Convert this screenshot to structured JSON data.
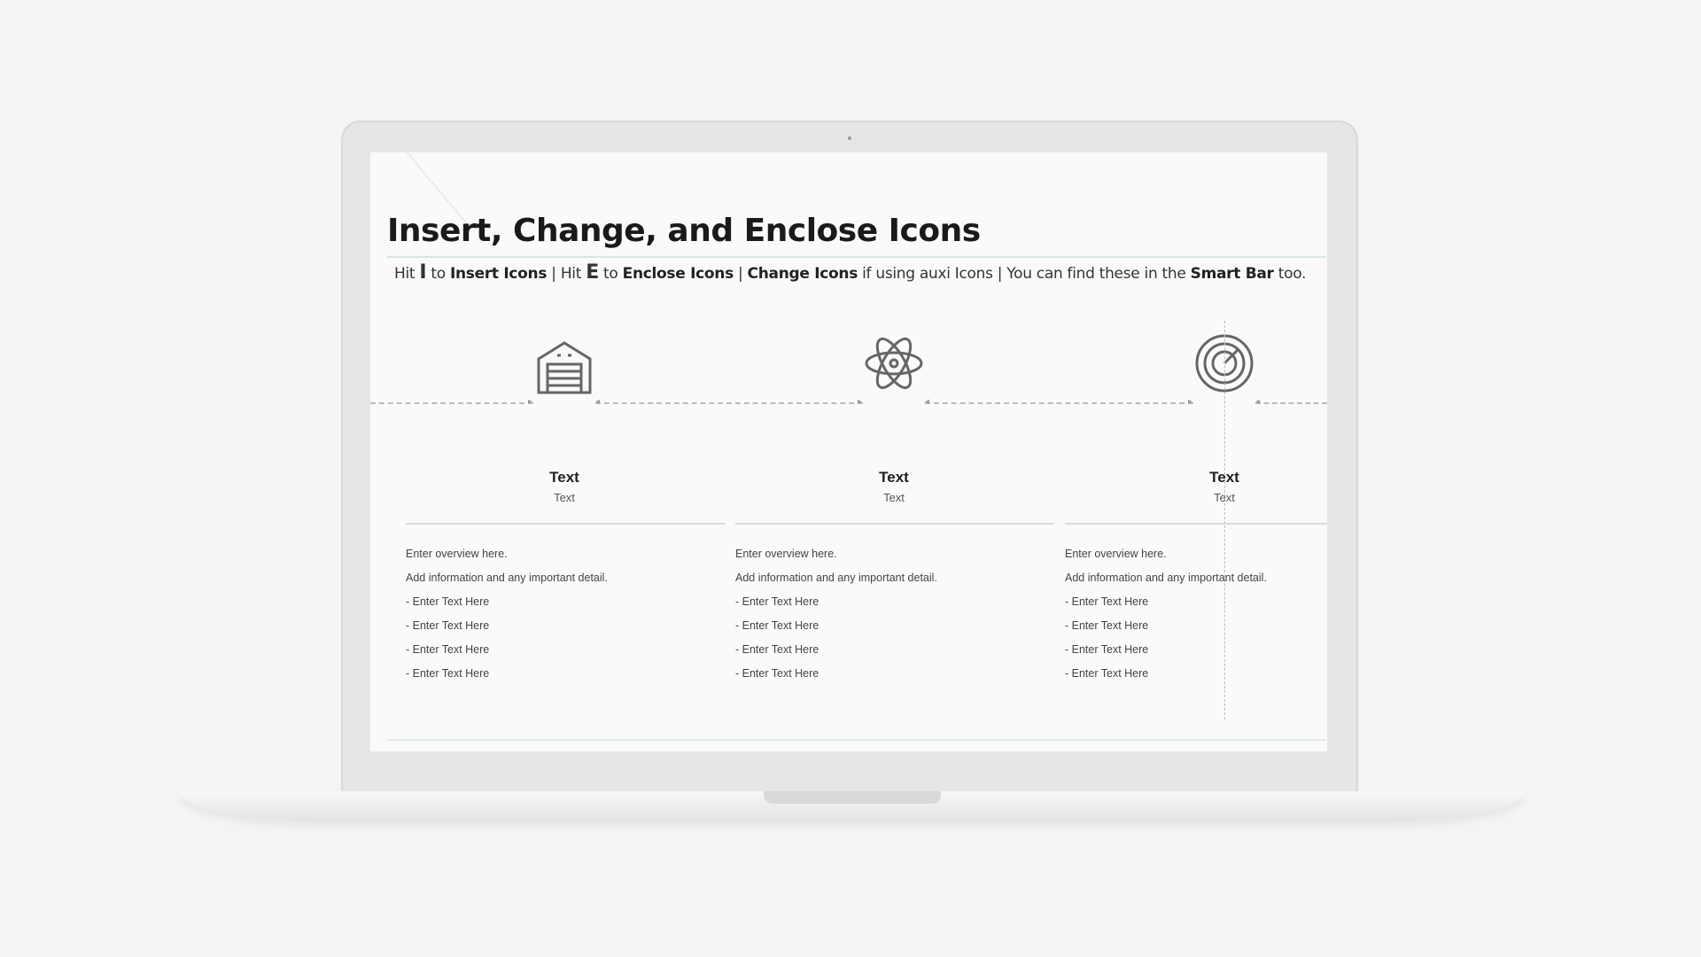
{
  "slide": {
    "title": "Insert, Change, and Enclose Icons",
    "subtitle": {
      "p1": "Hit ",
      "key_i": "I",
      "p2": " to ",
      "insert": "Insert Icons",
      "sep1": " |  Hit ",
      "key_e": "E",
      "p3": " to ",
      "enclose": "Enclose Icons",
      "sep2": " |  ",
      "change": "Change Icons",
      "p4": " if using auxi Icons |  You can find these in the ",
      "smartbar": "Smart Bar",
      "p5": " too."
    },
    "columns": [
      {
        "icon": "garage-icon",
        "title": "Text",
        "sub": "Text",
        "lines": [
          "Enter overview here.",
          "Add information and any important detail.",
          "- Enter Text Here",
          "- Enter Text Here",
          "- Enter Text Here",
          "- Enter Text Here"
        ]
      },
      {
        "icon": "atom-icon",
        "title": "Text",
        "sub": "Text",
        "lines": [
          "Enter overview here.",
          "Add information and any important detail.",
          "- Enter Text Here",
          "- Enter Text Here",
          "- Enter Text Here",
          "- Enter Text Here"
        ]
      },
      {
        "icon": "target-icon",
        "title": "Text",
        "sub": "Text",
        "lines": [
          "Enter overview here.",
          "Add information and any important detail.",
          "- Enter Text Here",
          "- Enter Text Here",
          "- Enter Text Here",
          "- Enter Text Here"
        ]
      }
    ]
  }
}
